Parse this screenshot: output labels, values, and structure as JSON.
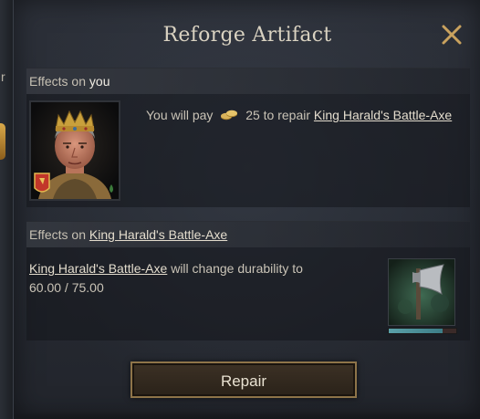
{
  "window": {
    "title": "Reforge Artifact",
    "close_icon": "close-icon"
  },
  "sidebar_edge": {
    "char": "r"
  },
  "effects_you": {
    "prefix": "Effects on ",
    "target": "you",
    "pay_prefix": "You will pay",
    "coin_icon": "gold-coin-icon",
    "amount": "25",
    "pay_middle": "to repair",
    "artifact": "King Harald's Battle-Axe"
  },
  "effects_artifact": {
    "prefix": "Effects on ",
    "artifact": "King Harald's Battle-Axe",
    "change_text": " will change durability to",
    "durability": "60.00 / 75.00",
    "durability_fraction": 0.8
  },
  "repair_button": {
    "label": "Repair"
  },
  "colors": {
    "accent_gold": "#8e7449",
    "panel": "#2c3039",
    "text": "#c9c3b6",
    "close": "#c9a25e"
  }
}
